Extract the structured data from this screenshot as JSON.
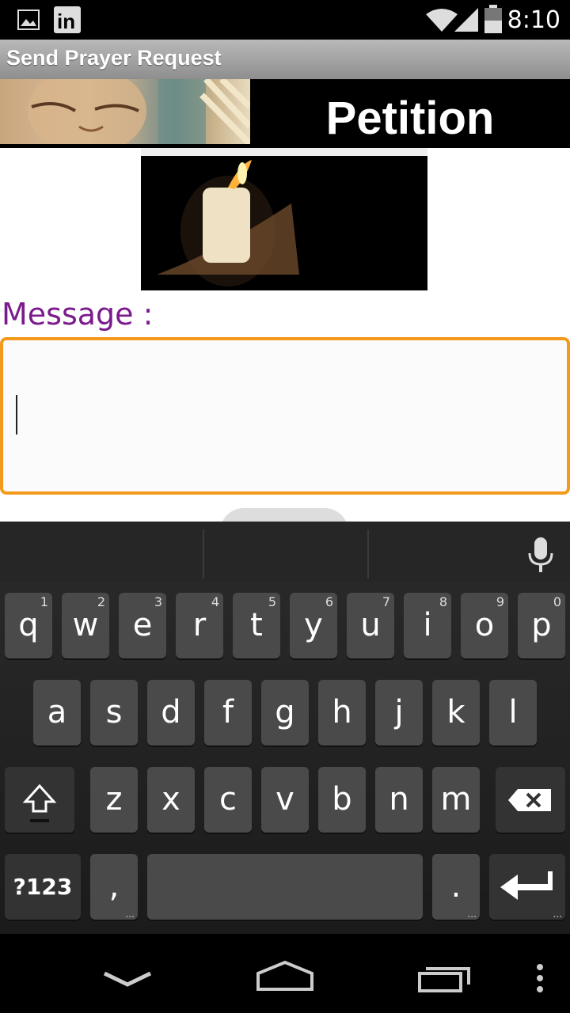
{
  "status_bar": {
    "time": "8:10"
  },
  "titlebar": {
    "title": "Send Prayer Request"
  },
  "header": {
    "title": "Petition"
  },
  "form": {
    "message_label": "Message :",
    "message_value": ""
  },
  "keyboard": {
    "row1": [
      {
        "k": "q",
        "n": "1"
      },
      {
        "k": "w",
        "n": "2"
      },
      {
        "k": "e",
        "n": "3"
      },
      {
        "k": "r",
        "n": "4"
      },
      {
        "k": "t",
        "n": "5"
      },
      {
        "k": "y",
        "n": "6"
      },
      {
        "k": "u",
        "n": "7"
      },
      {
        "k": "i",
        "n": "8"
      },
      {
        "k": "o",
        "n": "9"
      },
      {
        "k": "p",
        "n": "0"
      }
    ],
    "row2": [
      "a",
      "s",
      "d",
      "f",
      "g",
      "h",
      "j",
      "k",
      "l"
    ],
    "row3": [
      "z",
      "x",
      "c",
      "v",
      "b",
      "n",
      "m"
    ],
    "symbols_key": "?123",
    "comma_key": ",",
    "period_key": "."
  }
}
